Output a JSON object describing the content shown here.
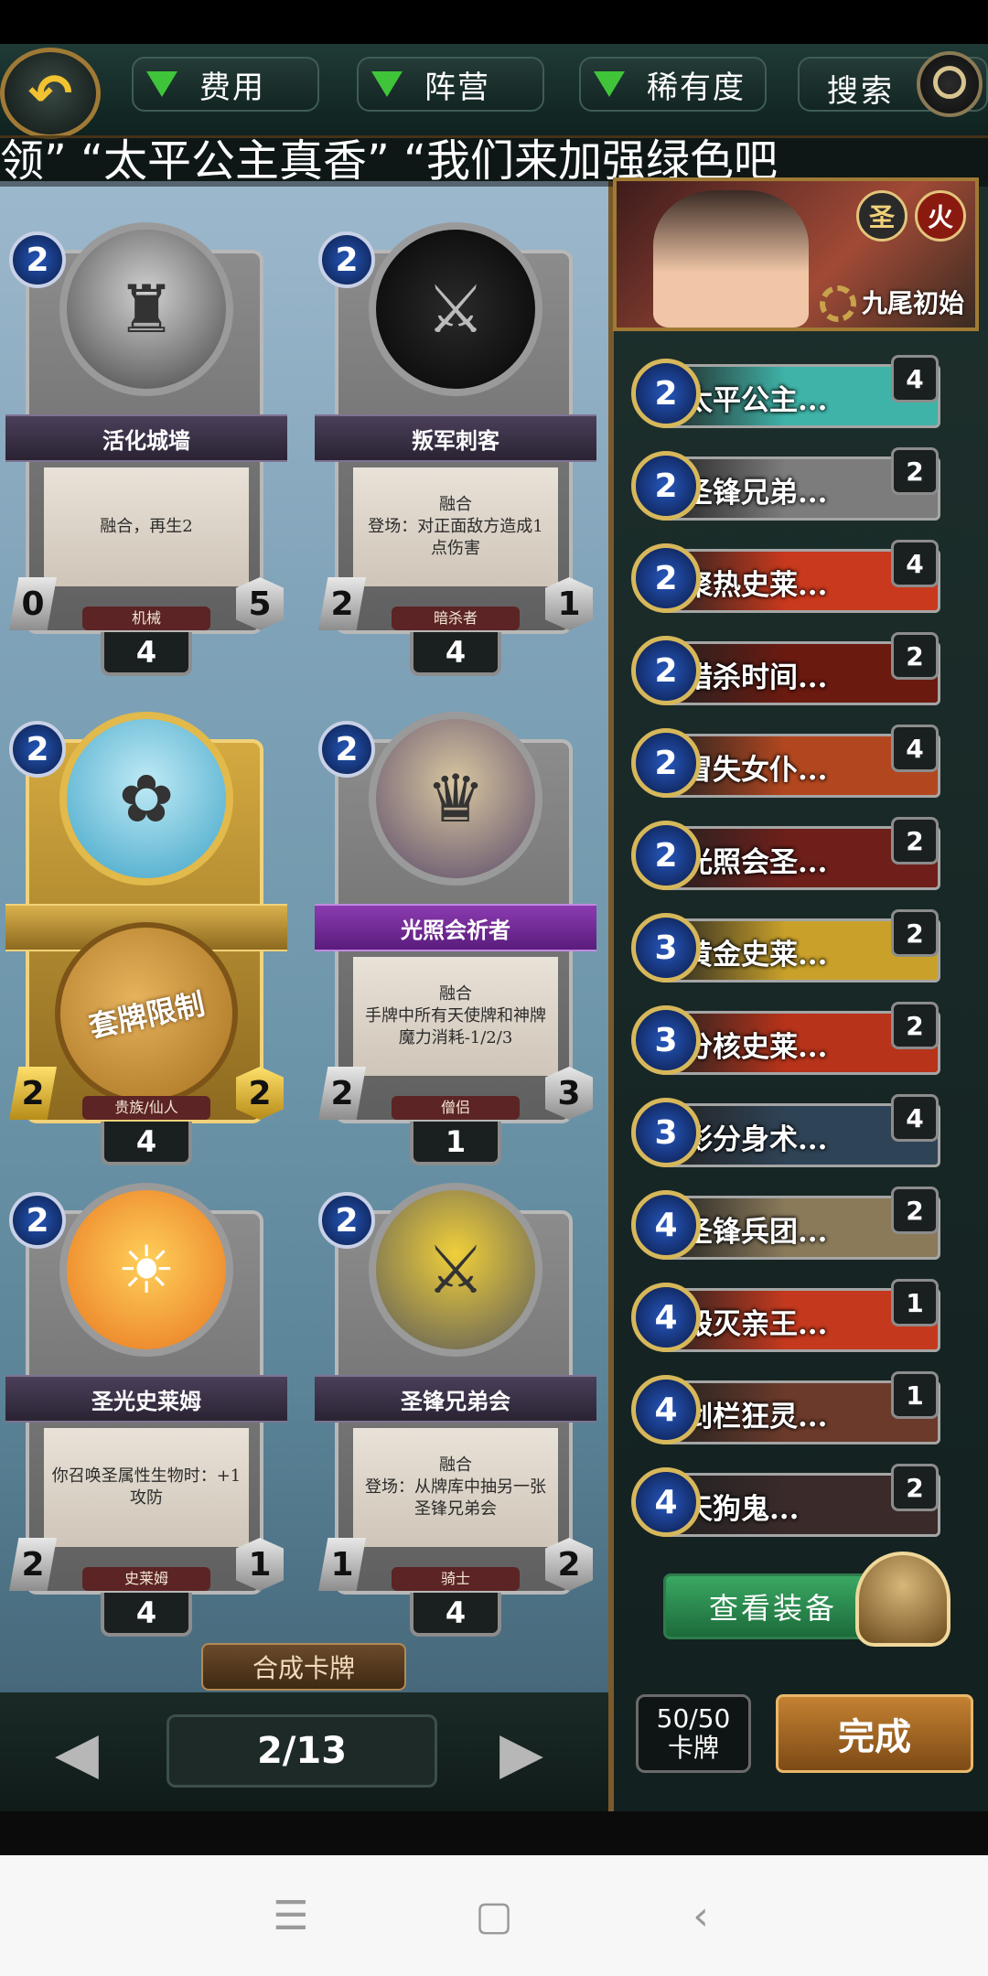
{
  "filters": {
    "cost": "费用",
    "faction": "阵营",
    "rarity": "稀有度"
  },
  "search": {
    "label": "搜索"
  },
  "marquee": "领” “太平公主真香” “我们来加强绿色吧",
  "cards": [
    {
      "name": "活化城墙",
      "text": "融合，再生2",
      "cost": "2",
      "attack": "0",
      "health": "5",
      "tribe": "机械",
      "count": "4"
    },
    {
      "name": "叛军刺客",
      "text": "融合\n登场：对正面敌方造成1点伤害",
      "cost": "2",
      "attack": "2",
      "health": "1",
      "tribe": "暗杀者",
      "count": "4"
    },
    {
      "name": "",
      "text": "",
      "cost": "2",
      "attack": "2",
      "health": "2",
      "tribe": "贵族/仙人",
      "count": "4",
      "restriction": "套牌限制"
    },
    {
      "name": "光照会祈者",
      "text": "融合\n手牌中所有天使牌和神牌魔力消耗-1/2/3",
      "cost": "2",
      "attack": "2",
      "health": "3",
      "tribe": "僧侣",
      "count": "1"
    },
    {
      "name": "圣光史莱姆",
      "text": "你召唤圣属性生物时：+1攻防",
      "cost": "2",
      "attack": "2",
      "health": "1",
      "tribe": "史莱姆",
      "count": "4"
    },
    {
      "name": "圣锋兄弟会",
      "text": "融合\n登场：从牌库中抽另一张圣锋兄弟会",
      "cost": "2",
      "attack": "1",
      "health": "2",
      "tribe": "骑士",
      "count": "4"
    }
  ],
  "combine_label": "合成卡牌",
  "page": "2/13",
  "leader": {
    "name": "九尾初始",
    "badges": [
      "圣",
      "火"
    ]
  },
  "deck": [
    {
      "cost": "2",
      "name": "太平公主...",
      "count": "4",
      "color": "#3fb3a8"
    },
    {
      "cost": "2",
      "name": "圣锋兄弟...",
      "count": "2",
      "color": "#7c7c7c"
    },
    {
      "cost": "2",
      "name": "聚热史莱...",
      "count": "4",
      "color": "#c8391d"
    },
    {
      "cost": "2",
      "name": "猎杀时间...",
      "count": "2",
      "color": "#6b1a10"
    },
    {
      "cost": "2",
      "name": "冒失女仆...",
      "count": "4",
      "color": "#b2471f"
    },
    {
      "cost": "2",
      "name": "光照会圣...",
      "count": "2",
      "color": "#6e1f1a"
    },
    {
      "cost": "3",
      "name": "黄金史莱...",
      "count": "2",
      "color": "#c9a12a"
    },
    {
      "cost": "3",
      "name": "分核史莱...",
      "count": "2",
      "color": "#b7331a"
    },
    {
      "cost": "3",
      "name": "影分身术...",
      "count": "4",
      "color": "#2f4356"
    },
    {
      "cost": "4",
      "name": "圣锋兵团...",
      "count": "2",
      "color": "#8a7a5a"
    },
    {
      "cost": "4",
      "name": "毁灭亲王...",
      "count": "1",
      "color": "#c4391e"
    },
    {
      "cost": "4",
      "name": "剑栏狂灵...",
      "count": "1",
      "color": "#6b3a2a"
    },
    {
      "cost": "4",
      "name": "天狗鬼...",
      "count": "2",
      "color": "#3a2a2a"
    }
  ],
  "view_equipment": "查看装备",
  "card_count": {
    "value": "50/50",
    "label": "卡牌"
  },
  "done": "完成"
}
